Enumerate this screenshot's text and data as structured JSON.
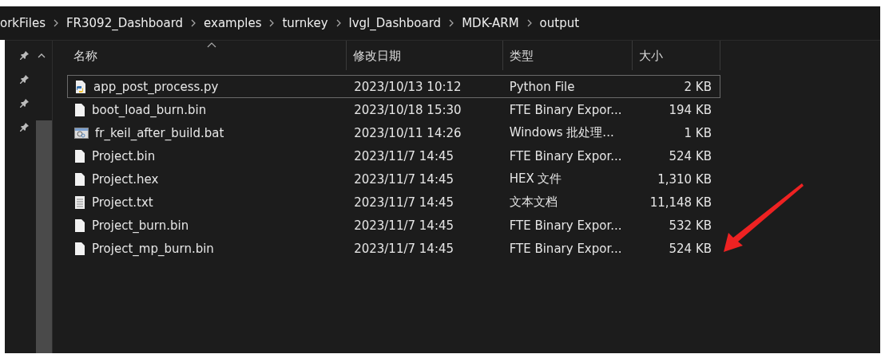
{
  "breadcrumb": [
    "orkFiles",
    "FR3092_Dashboard",
    "examples",
    "turnkey",
    "lvgl_Dashboard",
    "MDK-ARM",
    "output"
  ],
  "columns": [
    {
      "label": "名称",
      "sorted": true
    },
    {
      "label": "修改日期",
      "sorted": false
    },
    {
      "label": "类型",
      "sorted": false
    },
    {
      "label": "大小",
      "sorted": false
    }
  ],
  "files": [
    {
      "name": "app_post_process.py",
      "date": "2023/10/13 10:12",
      "type": "Python File",
      "size": "2 KB",
      "kind": "python",
      "focused": true
    },
    {
      "name": "boot_load_burn.bin",
      "date": "2023/10/18 15:30",
      "type": "FTE Binary Expor...",
      "size": "194 KB",
      "kind": "blank",
      "focused": false
    },
    {
      "name": "fr_keil_after_build.bat",
      "date": "2023/10/11 14:26",
      "type": "Windows 批处理...",
      "size": "1 KB",
      "kind": "batch",
      "focused": false
    },
    {
      "name": "Project.bin",
      "date": "2023/11/7 14:45",
      "type": "FTE Binary Expor...",
      "size": "524 KB",
      "kind": "blank",
      "focused": false
    },
    {
      "name": "Project.hex",
      "date": "2023/11/7 14:45",
      "type": "HEX 文件",
      "size": "1,310 KB",
      "kind": "blank",
      "focused": false
    },
    {
      "name": "Project.txt",
      "date": "2023/11/7 14:45",
      "type": "文本文档",
      "size": "11,148 KB",
      "kind": "text",
      "focused": false
    },
    {
      "name": "Project_burn.bin",
      "date": "2023/11/7 14:45",
      "type": "FTE Binary Expor...",
      "size": "532 KB",
      "kind": "blank",
      "focused": false
    },
    {
      "name": "Project_mp_burn.bin",
      "date": "2023/11/7 14:45",
      "type": "FTE Binary Expor...",
      "size": "524 KB",
      "kind": "blank",
      "focused": false
    }
  ]
}
